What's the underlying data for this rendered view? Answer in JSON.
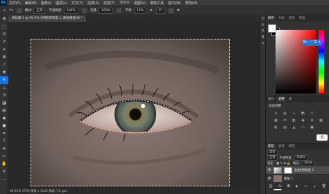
{
  "menu": {
    "logo": "Ps",
    "items": [
      "文件(F)",
      "编辑(E)",
      "图像(I)",
      "图层(L)",
      "文字(Y)",
      "选择(S)",
      "滤镜(T)",
      "3D(D)",
      "视图(V)",
      "增效工具",
      "窗口(W)",
      "帮助(H)"
    ]
  },
  "options": {
    "mode_label": "模式:",
    "mode_value": "正常",
    "opacity_label": "不透明度:",
    "opacity_value": "100%",
    "flow_label": "流量:",
    "flow_value": "100%",
    "smooth_label": "平滑:",
    "smooth_value": "10%",
    "angle_value": "0°"
  },
  "document": {
    "tab_title": "未标题-1 @ 90.9% (色相/饱和度 1, 图层蒙版/8) *",
    "status": "90.91%   1795 像素 x 1135 像素 (72 ppi)"
  },
  "tools": [
    "move",
    "marquee",
    "lasso",
    "quick-select",
    "crop",
    "frame",
    "eyedropper",
    "healing",
    "brush",
    "stamp",
    "history-brush",
    "eraser",
    "gradient",
    "blur",
    "dodge",
    "pen",
    "type",
    "path-select",
    "shape",
    "hand",
    "zoom",
    "more"
  ],
  "active_tool": 8,
  "color_panel": {
    "tabs": [
      "颜色",
      "色板",
      "渐变",
      "图案"
    ],
    "foreground": "#ffffff",
    "background": "#000000",
    "ime_badge": "En · ° ☰ ✦"
  },
  "adjustments_panel": {
    "tabs": [
      "属性",
      "调整",
      "库"
    ],
    "title": "添加调整",
    "brand_badge": "S"
  },
  "layers_panel": {
    "tabs": [
      "图层",
      "通道",
      "路径"
    ],
    "kind_label": "类型",
    "blend_mode": "正常",
    "opacity_label": "不透明度:",
    "opacity_value": "100%",
    "lock_label": "锁定:",
    "fill_label": "填充:",
    "fill_value": "100%",
    "layers": [
      {
        "name": "色相/饱和度 1",
        "type": "adjustment",
        "selected": true
      },
      {
        "name": "图层 1",
        "type": "pixel",
        "selected": false
      },
      {
        "name": "背景",
        "type": "background",
        "selected": false
      }
    ]
  },
  "colors": {
    "accent": "#1473e6",
    "panel_bg": "#323232",
    "canvas_bg": "#282828",
    "skin": "#7a6a63"
  }
}
